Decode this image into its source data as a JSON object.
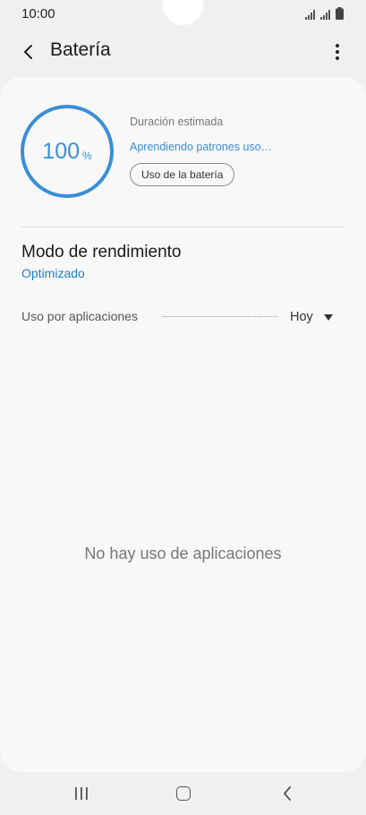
{
  "status_bar": {
    "time": "10:00",
    "icons": [
      "signal-icon",
      "signal-icon",
      "battery-icon"
    ]
  },
  "header": {
    "title": "Batería",
    "back_icon": "back-arrow-icon",
    "more_icon": "more-vertical-icon"
  },
  "battery": {
    "level_percent": 100,
    "percent_value": "100",
    "percent_sign": "%",
    "estimated_label": "Duración estimada",
    "learning_text": "Aprendiendo patrones uso…",
    "usage_button": "Uso de la batería"
  },
  "performance": {
    "title": "Modo de rendimiento",
    "value": "Optimizado"
  },
  "app_usage": {
    "label": "Uso por aplicaciones",
    "period": "Hoy",
    "empty_text": "No hay uso de aplicaciones"
  },
  "colors": {
    "accent": "#3a8fd6",
    "link": "#1f7ec6",
    "background": "#f0f0f0",
    "card": "#f8f8f8"
  },
  "nav_bar": {
    "icons": [
      "recent-apps-icon",
      "home-icon",
      "back-icon"
    ]
  }
}
